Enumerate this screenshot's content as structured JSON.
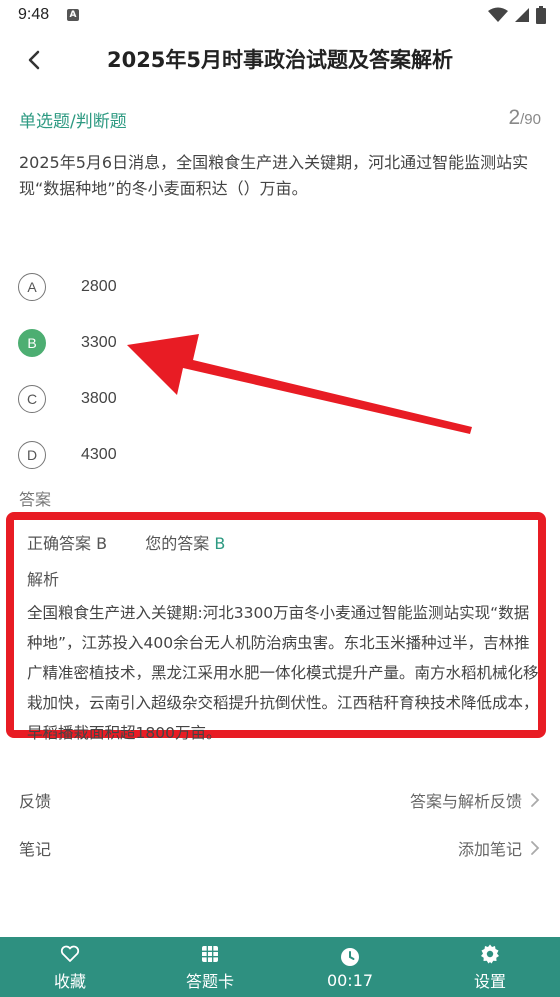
{
  "status_bar": {
    "time": "9:48"
  },
  "header": {
    "title": "2025年5月时事政治试题及答案解析"
  },
  "question": {
    "type": "单选题/判断题",
    "current": "2",
    "total": "/90",
    "text": "2025年5月6日消息，全国粮食生产进入关键期，河北通过智能监测站实现“数据种地”的冬小麦面积达（）万亩。"
  },
  "options": [
    {
      "letter": "A",
      "text": "2800",
      "selected": false
    },
    {
      "letter": "B",
      "text": "3300",
      "selected": true
    },
    {
      "letter": "C",
      "text": "3800",
      "selected": false
    },
    {
      "letter": "D",
      "text": "4300",
      "selected": false
    }
  ],
  "answer": {
    "section_label": "答案",
    "correct_label": "正确答案",
    "correct_value": "B",
    "yours_label": "您的答案",
    "yours_value": "B",
    "analysis_label": "解析",
    "analysis_text": "全国粮食生产进入关键期:河北3300万亩冬小麦通过智能监测站实现“数据种地”，江苏投入400余台无人机防治病虫害。东北玉米播种过半，吉林推广精准密植技术，黑龙江采用水肥一体化模式提升产量。南方水稻机械化移栽加快，云南引入超级杂交稻提升抗倒伏性。江西秸秆育秧技术降低成本，早稻播栽面积超1800万亩。"
  },
  "feedback": {
    "label": "反馈",
    "action": "答案与解析反馈"
  },
  "notes": {
    "label": "笔记",
    "action": "添加笔记"
  },
  "tabbar": {
    "favorite": "收藏",
    "answer_card": "答题卡",
    "timer": "00:17",
    "settings": "设置"
  },
  "colors": {
    "accent": "#2e9a82",
    "tabbar": "#2e9080",
    "highlight": "#e81c24",
    "selected_option": "#4dae72"
  }
}
